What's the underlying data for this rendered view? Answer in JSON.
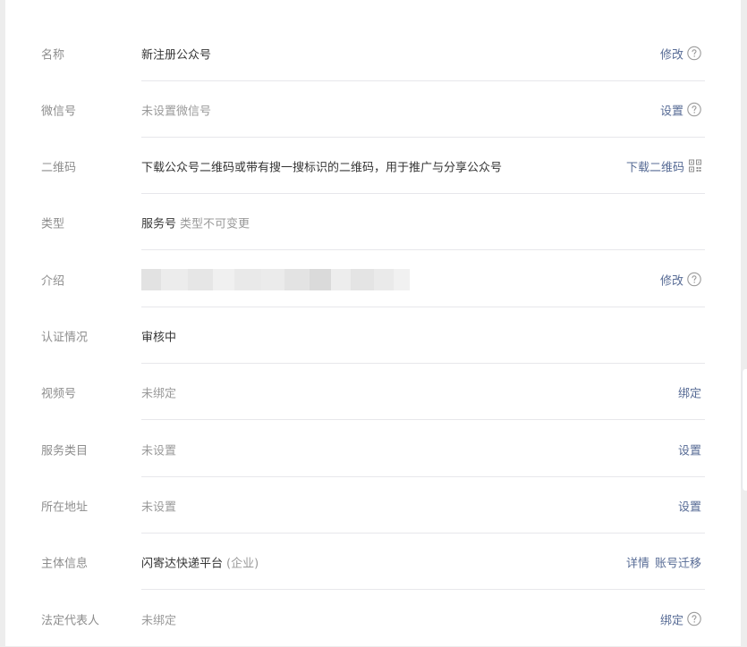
{
  "rows": [
    {
      "label": "名称",
      "value": "新注册公众号",
      "actions": [
        "修改"
      ],
      "icon": "help-circle-icon"
    },
    {
      "label": "微信号",
      "value": "未设置微信号",
      "actions": [
        "设置"
      ],
      "icon": "help-circle-icon"
    },
    {
      "label": "二维码",
      "value": "下载公众号二维码或带有搜一搜标识的二维码，用于推广与分享公众号",
      "actions": [
        "下载二维码"
      ],
      "icon": "qr-code-icon"
    },
    {
      "label": "类型",
      "value": "服务号",
      "sub": "类型不可变更"
    },
    {
      "label": "介绍",
      "actions": [
        "修改"
      ],
      "icon": "help-circle-icon"
    },
    {
      "label": "认证情况",
      "value": "审核中"
    },
    {
      "label": "视频号",
      "value": "未绑定",
      "actions": [
        "绑定"
      ]
    },
    {
      "label": "服务类目",
      "value": "未设置",
      "actions": [
        "设置"
      ]
    },
    {
      "label": "所在地址",
      "value": "未设置",
      "actions": [
        "设置"
      ]
    },
    {
      "label": "主体信息",
      "value": "闪寄达快递平台",
      "sub": "(企业)",
      "actions": [
        "详情",
        "账号迁移"
      ]
    },
    {
      "label": "法定代表人",
      "value": "未绑定",
      "actions": [
        "绑定"
      ],
      "icon": "help-circle-icon"
    }
  ],
  "colors": {
    "link": "#576b95",
    "label": "#8d8d8d",
    "text": "#353535",
    "muted": "#9a9a9a",
    "divider": "#e7e7eb"
  }
}
